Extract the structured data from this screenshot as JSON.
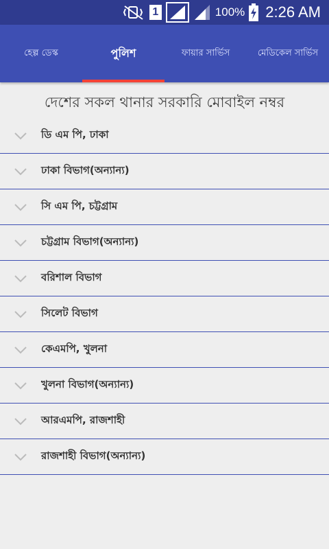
{
  "status_bar": {
    "icons": [
      "mute-vibrate-icon",
      "sim-1-icon",
      "signal-icon",
      "signal-icon",
      "battery-charging-icon"
    ],
    "sim_label": "1",
    "battery_percent": "100%",
    "time": "2:26 AM"
  },
  "tabs": [
    {
      "label": "হেল্প ডেস্ক",
      "active": false
    },
    {
      "label": "পুলিশ",
      "active": true
    },
    {
      "label": "ফায়ার সার্ভিস",
      "active": false
    },
    {
      "label": "মেডিকেল সার্ভিস",
      "active": false
    }
  ],
  "page_title": "দেশের সকল থানার সরকারি মোবাইল নম্বর",
  "list": {
    "items": [
      {
        "label": "ডি এম পি, ঢাকা"
      },
      {
        "label": "ঢাকা বিভাগ(অন্যান্য)"
      },
      {
        "label": "সি এম পি, চট্টগ্রাম"
      },
      {
        "label": "চট্টগ্রাম বিভাগ(অন্যান্য)"
      },
      {
        "label": "বরিশাল বিভাগ"
      },
      {
        "label": "সিলেট বিভাগ"
      },
      {
        "label": "কেএমপি, খুলনা"
      },
      {
        "label": "খুলনা বিভাগ(অন্যান্য)"
      },
      {
        "label": "আরএমপি, রাজশাহী"
      },
      {
        "label": "রাজশাহী বিভাগ(অন্যান্য)"
      }
    ]
  },
  "colors": {
    "status_bar": "#2f3b8f",
    "tab_bar": "#3e4fb3",
    "tab_indicator": "#f44336",
    "divider": "#3e4fb3"
  }
}
